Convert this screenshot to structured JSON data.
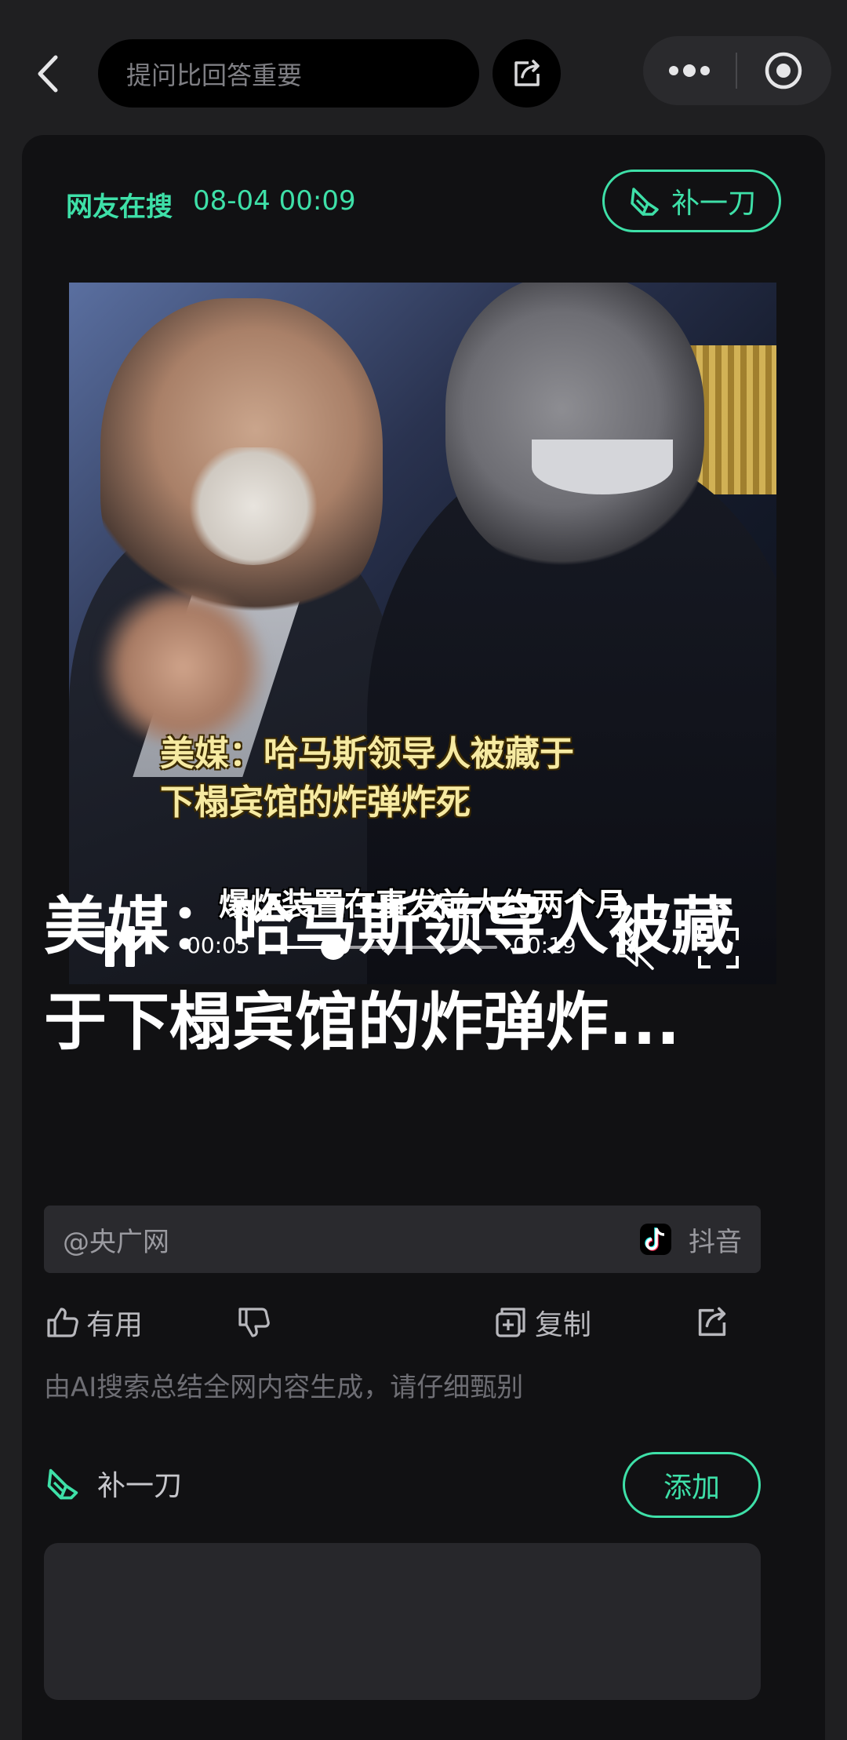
{
  "topbar": {
    "search_placeholder": "提问比回答重要"
  },
  "card": {
    "meta_source": "网友在搜",
    "meta_time": "08-04 00:09",
    "patch_button": "补一刀"
  },
  "video": {
    "caption_line1": "美媒：哈马斯领导人被藏于",
    "caption_line2": "下榻宾馆的炸弹炸死",
    "subtitle": "爆炸装置在事发前大约两个月",
    "current_time": "00:05",
    "total_time": "00:19",
    "progress": 0.26
  },
  "article": {
    "headline": "美媒：哈马斯领导人被藏于下榻宾馆的炸弹炸..."
  },
  "source": {
    "author": "@央广网",
    "platform": "抖音"
  },
  "actions": {
    "useful": "有用",
    "copy": "复制",
    "disclaimer": "由AI搜索总结全网内容生成，请仔细甄别"
  },
  "patch_row": {
    "label": "补一刀",
    "add_button": "添加"
  },
  "colors": {
    "accent": "#3ee0a8",
    "background": "#1f1f21",
    "card": "#111113"
  }
}
